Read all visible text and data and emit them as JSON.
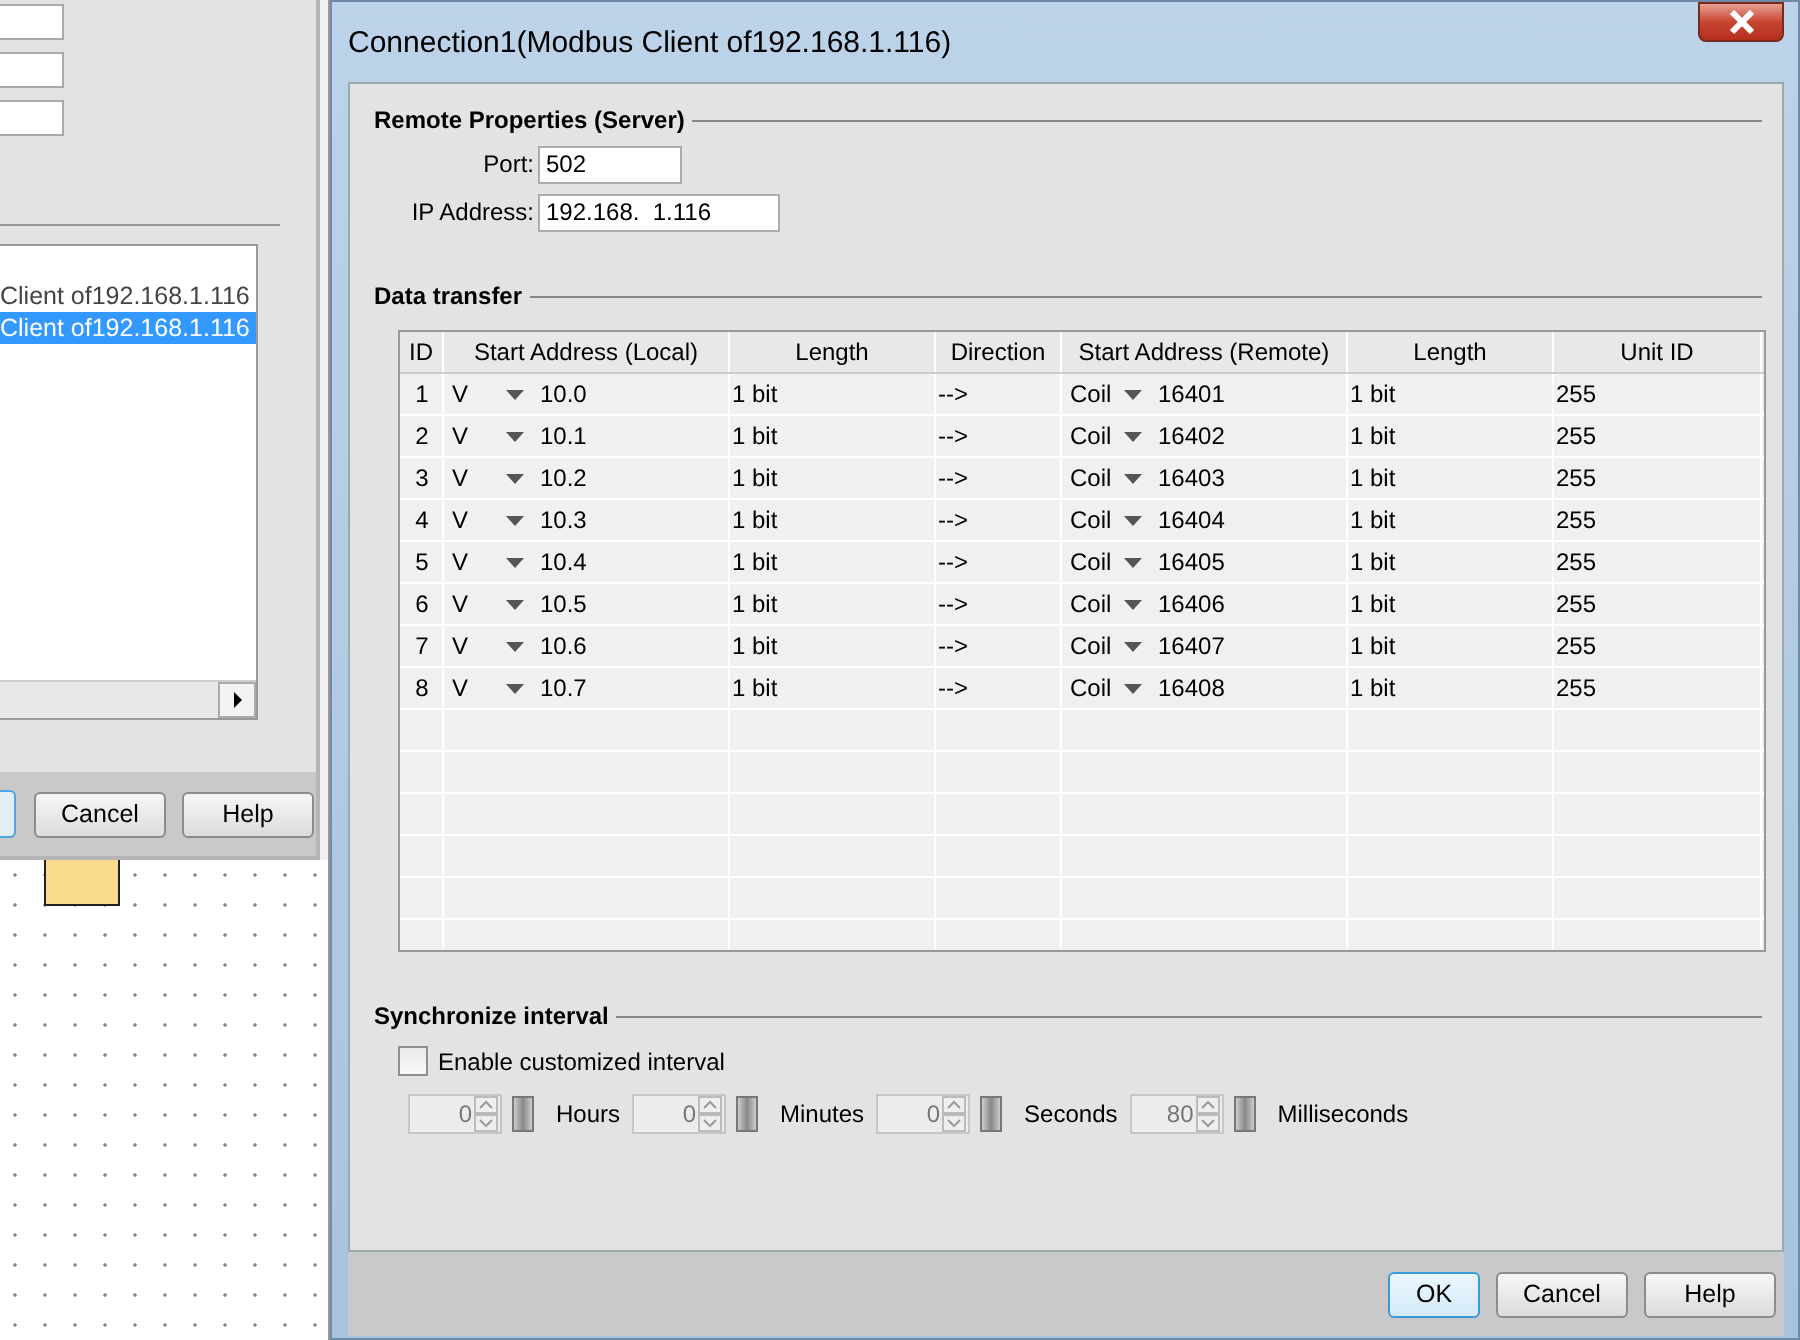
{
  "background_dialog": {
    "list_items": [
      {
        "label": "Client of192.168.1.116",
        "selected": false
      },
      {
        "label": "Client of192.168.1.116",
        "selected": true
      }
    ],
    "buttons": [
      "Cancel",
      "Help"
    ]
  },
  "window": {
    "title": "Connection1(Modbus Client of192.168.1.116)"
  },
  "remote_properties": {
    "title": "Remote Properties (Server)",
    "port_label": "Port:",
    "port": "502",
    "ip_label": "IP Address:",
    "ip": "192.168.  1.116"
  },
  "data_transfer": {
    "title": "Data transfer",
    "columns": [
      "ID",
      "Start Address (Local)",
      "Length",
      "Direction",
      "Start Address (Remote)",
      "Length",
      "Unit ID"
    ],
    "rows": [
      {
        "id": "1",
        "local_area": "V",
        "local_address": "10.0",
        "local_length": "1 bit",
        "direction": "-->",
        "remote_area": "Coil",
        "remote_address": "16401",
        "remote_length": "1 bit",
        "unit_id": "255"
      },
      {
        "id": "2",
        "local_area": "V",
        "local_address": "10.1",
        "local_length": "1 bit",
        "direction": "-->",
        "remote_area": "Coil",
        "remote_address": "16402",
        "remote_length": "1 bit",
        "unit_id": "255"
      },
      {
        "id": "3",
        "local_area": "V",
        "local_address": "10.2",
        "local_length": "1 bit",
        "direction": "-->",
        "remote_area": "Coil",
        "remote_address": "16403",
        "remote_length": "1 bit",
        "unit_id": "255"
      },
      {
        "id": "4",
        "local_area": "V",
        "local_address": "10.3",
        "local_length": "1 bit",
        "direction": "-->",
        "remote_area": "Coil",
        "remote_address": "16404",
        "remote_length": "1 bit",
        "unit_id": "255"
      },
      {
        "id": "5",
        "local_area": "V",
        "local_address": "10.4",
        "local_length": "1 bit",
        "direction": "-->",
        "remote_area": "Coil",
        "remote_address": "16405",
        "remote_length": "1 bit",
        "unit_id": "255"
      },
      {
        "id": "6",
        "local_area": "V",
        "local_address": "10.5",
        "local_length": "1 bit",
        "direction": "-->",
        "remote_area": "Coil",
        "remote_address": "16406",
        "remote_length": "1 bit",
        "unit_id": "255"
      },
      {
        "id": "7",
        "local_area": "V",
        "local_address": "10.6",
        "local_length": "1 bit",
        "direction": "-->",
        "remote_area": "Coil",
        "remote_address": "16407",
        "remote_length": "1 bit",
        "unit_id": "255"
      },
      {
        "id": "8",
        "local_area": "V",
        "local_address": "10.7",
        "local_length": "1 bit",
        "direction": "-->",
        "remote_area": "Coil",
        "remote_address": "16408",
        "remote_length": "1 bit",
        "unit_id": "255"
      }
    ]
  },
  "synchronize_interval": {
    "title": "Synchronize interval",
    "enable": {
      "label": "Enable customized interval",
      "checked": false
    },
    "spinners": [
      {
        "value": "0",
        "unit": "Hours"
      },
      {
        "value": "0",
        "unit": "Minutes"
      },
      {
        "value": "0",
        "unit": "Seconds"
      },
      {
        "value": "80",
        "unit": "Milliseconds"
      }
    ]
  },
  "buttons": [
    {
      "label": "OK",
      "default": true
    },
    {
      "label": "Cancel",
      "default": false
    },
    {
      "label": "Help",
      "default": false
    }
  ]
}
